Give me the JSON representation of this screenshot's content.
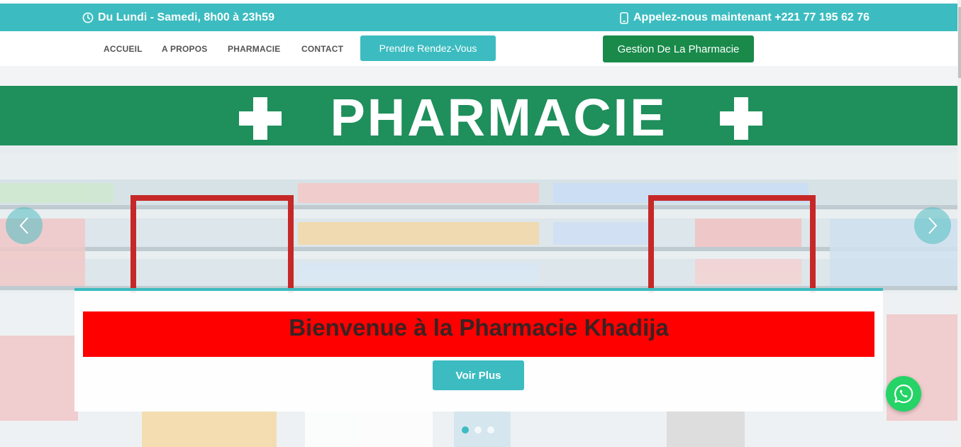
{
  "topbar": {
    "hours": "Du Lundi - Samedi, 8h00 à 23h59",
    "phone": "Appelez-nous maintenant +221 77 195 62 76"
  },
  "nav": {
    "items": [
      {
        "label": "ACCUEIL"
      },
      {
        "label": "A PROPOS"
      },
      {
        "label": "PHARMACIE"
      },
      {
        "label": "CONTACT"
      }
    ],
    "appointment_button": "Prendre Rendez-Vous",
    "management_button": "Gestion De La Pharmacie"
  },
  "hero": {
    "sign_text": "PHARMACIE",
    "title": "Bienvenue à la Pharmacie Khadija",
    "cta": "Voir Plus",
    "slides_count": 3,
    "active_slide": 1
  },
  "colors": {
    "accent": "#3cbcc0",
    "management": "#198a4a",
    "title_background": "#ff0000",
    "whatsapp": "#25d366"
  }
}
